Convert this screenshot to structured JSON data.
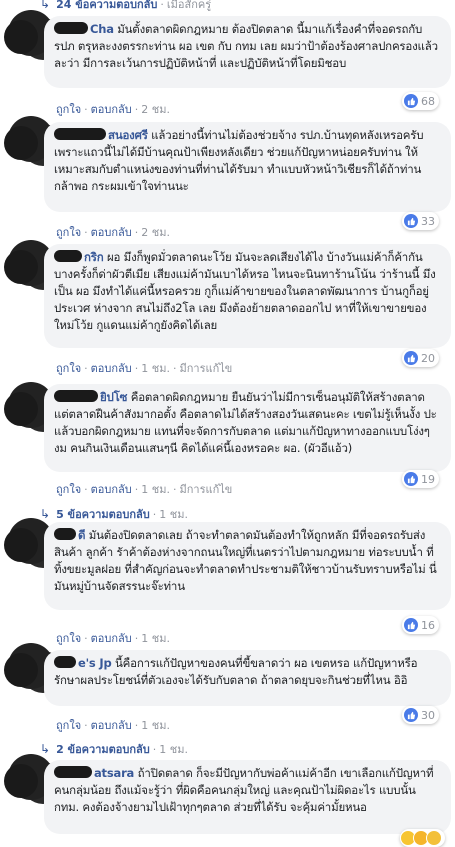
{
  "top": {
    "count_label": "24 ข้อความตอบกลับ",
    "sep": "·",
    "time": "เมื่อสักครู่"
  },
  "labels": {
    "like": "ถูกใจ",
    "reply": "ตอบกลับ",
    "dot": "·",
    "edited": "มีการแก้ไข"
  },
  "comments": [
    {
      "name": "Cha",
      "text": "มันตั้งตลาดผิดกฎหมาย ต้องปิดตลาด นี้มาแก้เรื่องคำที่จอดรถกับ รปภ ตรุหละงงตรรกะท่าน ผอ เขต กับ กทม เลย ผมว่าป้าต้องร้องศาลปกครองแล้วละว่า มีการละเว้นการปฏิบัติหน้าที่ และปฏิบัติหน้าที่โดยมิชอบ",
      "time": "2 ชม.",
      "count": "68",
      "emojis": [
        "like"
      ]
    },
    {
      "name": "สนองศรี",
      "text": "แล้วอย่างนี้ท่านไม่ต้องช่วยจ้าง รปภ.บ้านทุดหลังเหรอครับเพราะแถวนี้ไม่ได้มีบ้านคุณป้าเพียงหลังเดียว ช่วยแก้ปัญหาหน่อยครับท่าน ให้เหมาะสมกับตำแหน่งของท่านที่ท่านได้รับมา ทำแบบหัวหน้าวิเชียรก็ได้ถ้าท่านกล้าพอ กระผมเข้าใจท่านนะ",
      "time": "2 ชม.",
      "count": "33",
      "emojis": [
        "like"
      ]
    },
    {
      "name": "กริก",
      "text": "ผอ มึงก็พูดมั่วตลาดนะโว้ย มันจะลดเสียงได้ไง บ้างวันแม่ค้าก็ค้ากัน บางครั้งก็ด่าผัวตีเมีย เสียงแม่ค้ามันเบาได้หรอ ไหนจะนินทาร้านโน้น ว่าร้านนี้ มึงเป็น ผอ มึงทำได้แค่นี้หรอครวย กูก็แม่ค้าขายของในตลาดพัฒนาการ บ้านกูก็อยู่ประเวศ ห่างจาก สนไม่ถึง2โล เลย มึงต้องย้ายตลาดออกไป หาที่ให้เขาขายของใหม่โว้ย กูแดนแม่ค้ากูยังคิดได้เลย",
      "time": "1 ชม.",
      "edited": true,
      "count": "20",
      "emojis": [
        "like"
      ]
    },
    {
      "name": "ยิปโซ",
      "text": "คือตลาดผิดกฎหมาย ยืนยันว่าไม่มีการเซ็นอนุมัติให้สร้างตลาด แต่ตลาดฝืนค้าสังมากอตั้ง คือตลาดไม่ได้สร้างสองวันเสดนะคะ เขตไม่รู้เห็นงั้ง ปะ แล้วบอกผิดกฎหมาย แทนที่จะจัดการกับตลาด แต่มาแก้ปัญหาทางออกแบบโง่งๆงม คนกินเงินเดือนแสนๆนี คิดได้แค่นี้เองหรอคะ ผอ. (ผัวอีแอ้ว)",
      "time": "1 ชม.",
      "edited": true,
      "count": "19",
      "emojis": [
        "like"
      ]
    },
    {
      "name": "ดี",
      "text": "มันต้องปิดตลาดเลย ถ้าจะทำตลาดมันต้องทำให้ถูกหลัก มีที่จอดรถรับส่งสินค้า ลูกค้า รัาค้าต้องห่างจากถนนใหญ่ที่เนตรว่าไปตามกฎหมาย ท่อระบบน้ำ ที่ทิ้งขยะมูลฝอย ที่สำคัญก่อนจะทำตลาดทำประชามติให้ชาวบ้านรับทราบหรือไม่ นี่มันหมู่บ้านจัดสรรนะจ๊ะท่าน",
      "time": "1 ชม.",
      "count": "16",
      "emojis": [
        "like"
      ]
    },
    {
      "name": "e's Jp",
      "text": "นี้คือการแก้ปัญหาของคนที่ขี้ขลาดว่า ผอ เขตหรอ แก้ปัญหาหรือรักษาผลประโยชน์ที่ตัวเองจะได้รับกับตลาด ถ้าตลาดยุบจะกินช่วยที่ไหน อิอิ",
      "time": "1 ชม.",
      "count": "30",
      "emojis": [
        "like"
      ]
    },
    {
      "name": "atsara",
      "text": "ถ้าปิดตลาด ก็จะมีปัญหากับพ่อค้าแม่ค้าอีก เขาเลือกแก้ปัญหาที่คนกลุ่มน้อย ถึงแม้จะรู้ว่า ที่ผิดคือคนกลุ่มใหญ่ และคุณป้าไม่ผิดอะไร แบบนั้น กทม. คงต้องจ้างยามไปเฝ้าทุกๆตลาด ส่วยที่ได้รับ จะคุ้มค่ามั้ยหนอ",
      "time": "",
      "count": "",
      "emojis": [
        "haha",
        "wow",
        "sad"
      ]
    }
  ],
  "reply_threads": [
    {
      "label": "5 ข้อความตอบกลับ",
      "time": "1 ชม."
    },
    {
      "label": "2 ข้อความตอบกลับ",
      "time": "1 ชม."
    }
  ]
}
